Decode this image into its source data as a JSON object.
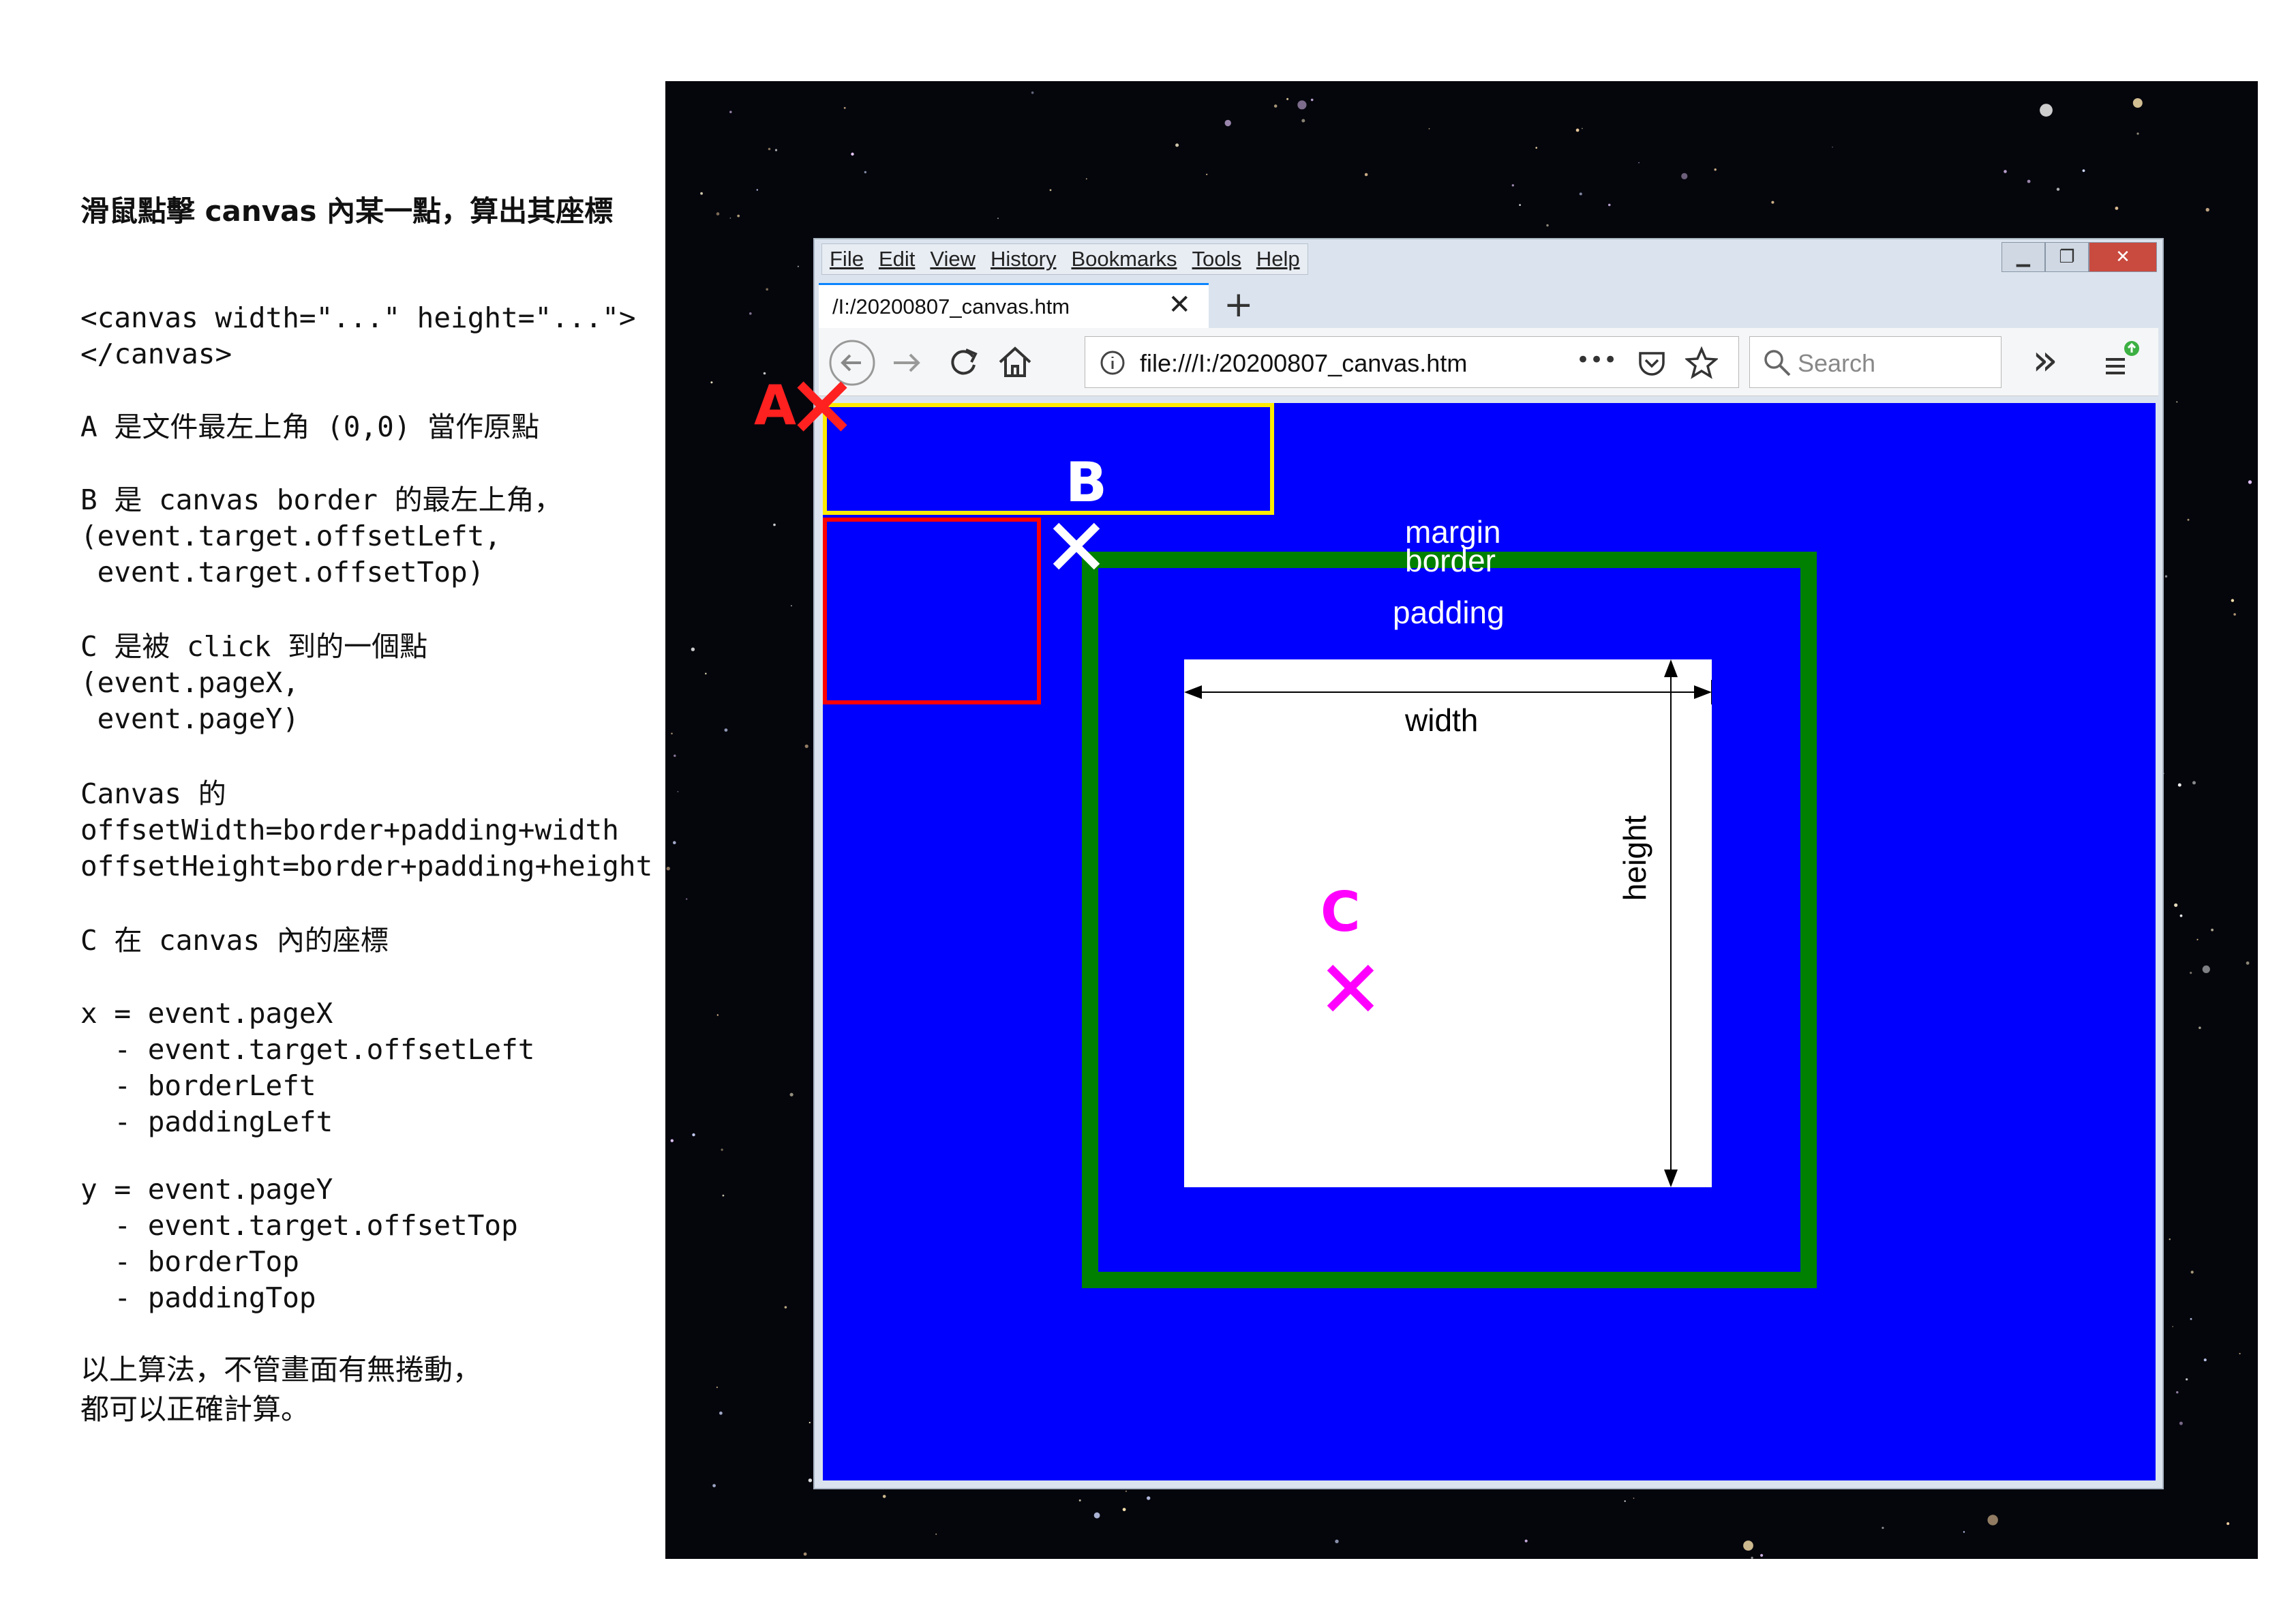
{
  "notes": {
    "title": "滑鼠點擊 canvas 內某一點，算出其座標",
    "canvas_tag": "<canvas width=\"...\" height=\"...\">\n</canvas>",
    "point_a": "A 是文件最左上角 (0,0) 當作原點",
    "point_b": "B 是 canvas border 的最左上角，\n(event.target.offsetLeft,\n event.target.offsetTop)",
    "point_c": "C 是被 click 到的一個點\n(event.pageX,\n event.pageY)",
    "canvas_dims": "Canvas 的\noffsetWidth=border+padding+width\noffsetHeight=border+padding+height",
    "c_in_canvas": "C 在 canvas 內的座標",
    "x_formula": "x = event.pageX\n  - event.target.offsetLeft\n  - borderLeft\n  - paddingLeft",
    "y_formula": "y = event.pageY\n  - event.target.offsetTop\n  - borderTop\n  - paddingTop",
    "conclusion": "以上算法，不管畫面有無捲動，\n都可以正確計算。"
  },
  "browser": {
    "menu": [
      "File",
      "Edit",
      "View",
      "History",
      "Bookmarks",
      "Tools",
      "Help"
    ],
    "tab_title": "/I:/20200807_canvas.htm",
    "tab_close": "✕",
    "new_tab": "+",
    "url": "file:///I:/20200807_canvas.htm",
    "url_more": "•••",
    "search_placeholder": "Search",
    "overflow": "»",
    "window_buttons": {
      "minimize": "▁",
      "restore": "❐",
      "close": "✕"
    }
  },
  "diagram": {
    "label_a": "A",
    "label_b": "B",
    "label_c": "C",
    "margin": "margin",
    "border": "border",
    "padding": "padding",
    "width": "width",
    "height": "height"
  },
  "colors": {
    "canvas_background": "#0000ff",
    "border": "#008000",
    "margin_box": "#ffeb00",
    "offset_box": "#ff0000",
    "mark_a": "#ff2020",
    "mark_b": "#ffffff",
    "mark_c": "#ff00ff"
  }
}
